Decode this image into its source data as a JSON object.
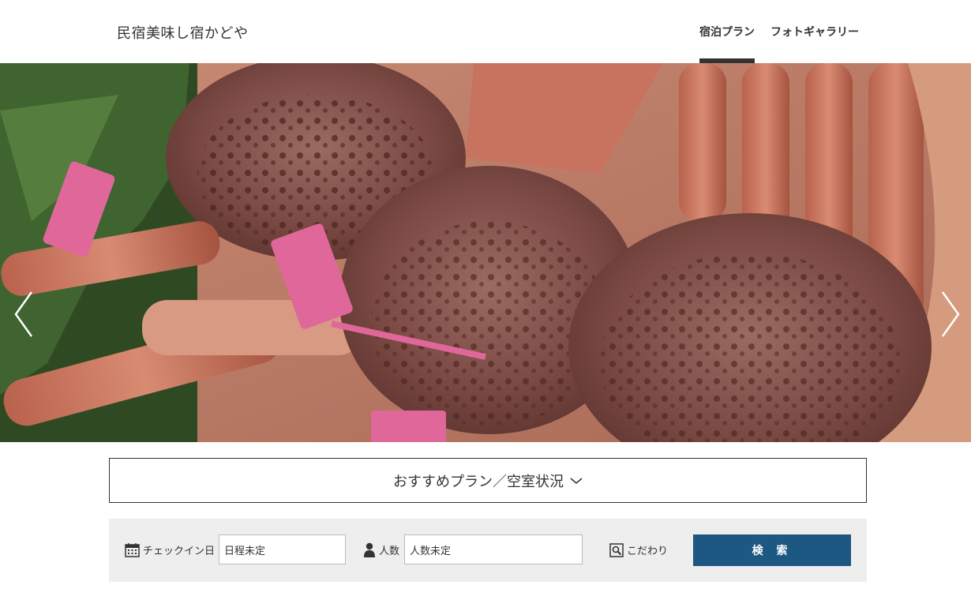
{
  "header": {
    "site_title": "民宿美味し宿かどや",
    "nav": [
      {
        "label": "宿泊プラン",
        "active": true
      },
      {
        "label": "フォトギャラリー",
        "active": false
      }
    ]
  },
  "hero": {
    "prev_icon": "chevron-left-icon",
    "next_icon": "chevron-right-icon"
  },
  "plan_toggle": {
    "label": "おすすめプラン／空室状況",
    "icon": "chevron-down-icon"
  },
  "search": {
    "checkin_label": "チェックイン日",
    "checkin_value": "日程未定",
    "guests_label": "人数",
    "guests_value": "人数未定",
    "kodawari_label": "こだわり",
    "button_label": "検 索",
    "button_color": "#1d5883"
  }
}
